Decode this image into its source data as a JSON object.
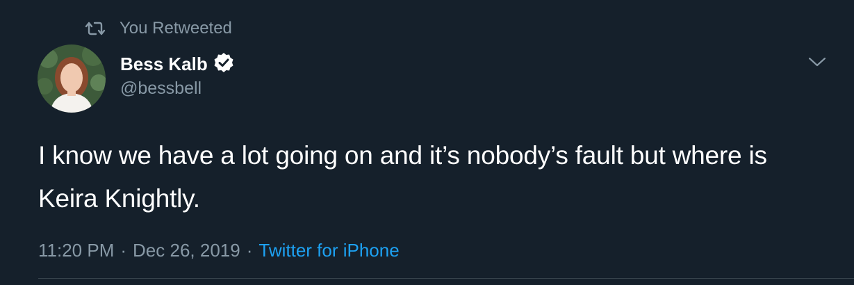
{
  "retweet": {
    "label": "You Retweeted",
    "icon": "retweet-icon"
  },
  "author": {
    "name": "Bess Kalb",
    "handle": "@bessbell",
    "verified": true,
    "avatar_icon": "avatar"
  },
  "tweet": {
    "text": "I know we have a lot going on and it’s nobody’s fault but where is Keira Knightly."
  },
  "meta": {
    "time": "11:20 PM",
    "separator": "·",
    "date": "Dec 26, 2019",
    "source": "Twitter for iPhone"
  },
  "menu": {
    "icon": "chevron-down-icon"
  },
  "colors": {
    "background": "#15202b",
    "secondary_text": "#8899a6",
    "link": "#1da1f2",
    "primary_text": "#ffffff",
    "divider": "#38444d"
  }
}
